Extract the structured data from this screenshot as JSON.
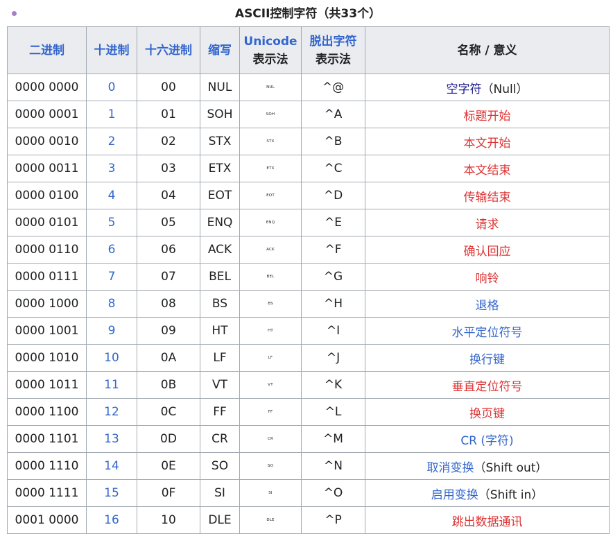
{
  "caption": "ASCII控制字符（共33个）",
  "headers": {
    "binary": "二进制",
    "decimal": "十进制",
    "hex": "十六进制",
    "abbr": "缩写",
    "unicode_line1": "Unicode",
    "unicode_line2": "表示法",
    "caret_line1": "脱出字符",
    "caret_line2": "表示法",
    "name": "名称 / 意义"
  },
  "rows": [
    {
      "bin": "0000 0000",
      "dec": "0",
      "hex": "00",
      "abbr": "NUL",
      "pic": "NUL",
      "caret": "^@",
      "name_link": "空字符",
      "name_extra": "（Null）",
      "link_style": "visited"
    },
    {
      "bin": "0000 0001",
      "dec": "1",
      "hex": "01",
      "abbr": "SOH",
      "pic": "SOH",
      "caret": "^A",
      "name_link": "标题开始",
      "name_extra": "",
      "link_style": "new"
    },
    {
      "bin": "0000 0010",
      "dec": "2",
      "hex": "02",
      "abbr": "STX",
      "pic": "STX",
      "caret": "^B",
      "name_link": "本文开始",
      "name_extra": "",
      "link_style": "new"
    },
    {
      "bin": "0000 0011",
      "dec": "3",
      "hex": "03",
      "abbr": "ETX",
      "pic": "ETX",
      "caret": "^C",
      "name_link": "本文结束",
      "name_extra": "",
      "link_style": "new"
    },
    {
      "bin": "0000 0100",
      "dec": "4",
      "hex": "04",
      "abbr": "EOT",
      "pic": "EOT",
      "caret": "^D",
      "name_link": "传输结束",
      "name_extra": "",
      "link_style": "new"
    },
    {
      "bin": "0000 0101",
      "dec": "5",
      "hex": "05",
      "abbr": "ENQ",
      "pic": "ENQ",
      "caret": "^E",
      "name_link": "请求",
      "name_extra": "",
      "link_style": "new"
    },
    {
      "bin": "0000 0110",
      "dec": "6",
      "hex": "06",
      "abbr": "ACK",
      "pic": "ACK",
      "caret": "^F",
      "name_link": "确认回应",
      "name_extra": "",
      "link_style": "new"
    },
    {
      "bin": "0000 0111",
      "dec": "7",
      "hex": "07",
      "abbr": "BEL",
      "pic": "BEL",
      "caret": "^G",
      "name_link": "响铃",
      "name_extra": "",
      "link_style": "new"
    },
    {
      "bin": "0000 1000",
      "dec": "8",
      "hex": "08",
      "abbr": "BS",
      "pic": "BS",
      "caret": "^H",
      "name_link": "退格",
      "name_extra": "",
      "link_style": "link"
    },
    {
      "bin": "0000 1001",
      "dec": "9",
      "hex": "09",
      "abbr": "HT",
      "pic": "HT",
      "caret": "^I",
      "name_link": "水平定位符号",
      "name_extra": "",
      "link_style": "link"
    },
    {
      "bin": "0000 1010",
      "dec": "10",
      "hex": "0A",
      "abbr": "LF",
      "pic": "LF",
      "caret": "^J",
      "name_link": "换行键",
      "name_extra": "",
      "link_style": "link"
    },
    {
      "bin": "0000 1011",
      "dec": "11",
      "hex": "0B",
      "abbr": "VT",
      "pic": "VT",
      "caret": "^K",
      "name_link": "垂直定位符号",
      "name_extra": "",
      "link_style": "new"
    },
    {
      "bin": "0000 1100",
      "dec": "12",
      "hex": "0C",
      "abbr": "FF",
      "pic": "FF",
      "caret": "^L",
      "name_link": "换页键",
      "name_extra": "",
      "link_style": "new"
    },
    {
      "bin": "0000 1101",
      "dec": "13",
      "hex": "0D",
      "abbr": "CR",
      "pic": "CR",
      "caret": "^M",
      "name_link": "CR (字符)",
      "name_extra": "",
      "link_style": "link"
    },
    {
      "bin": "0000 1110",
      "dec": "14",
      "hex": "0E",
      "abbr": "SO",
      "pic": "SO",
      "caret": "^N",
      "name_link": "取消变换",
      "name_extra": "（Shift out）",
      "link_style": "link"
    },
    {
      "bin": "0000 1111",
      "dec": "15",
      "hex": "0F",
      "abbr": "SI",
      "pic": "SI",
      "caret": "^O",
      "name_link": "启用变换",
      "name_extra": "（Shift in）",
      "link_style": "link"
    },
    {
      "bin": "0001 0000",
      "dec": "16",
      "hex": "10",
      "abbr": "DLE",
      "pic": "DLE",
      "caret": "^P",
      "name_link": "跳出数据通讯",
      "name_extra": "",
      "link_style": "new"
    }
  ]
}
